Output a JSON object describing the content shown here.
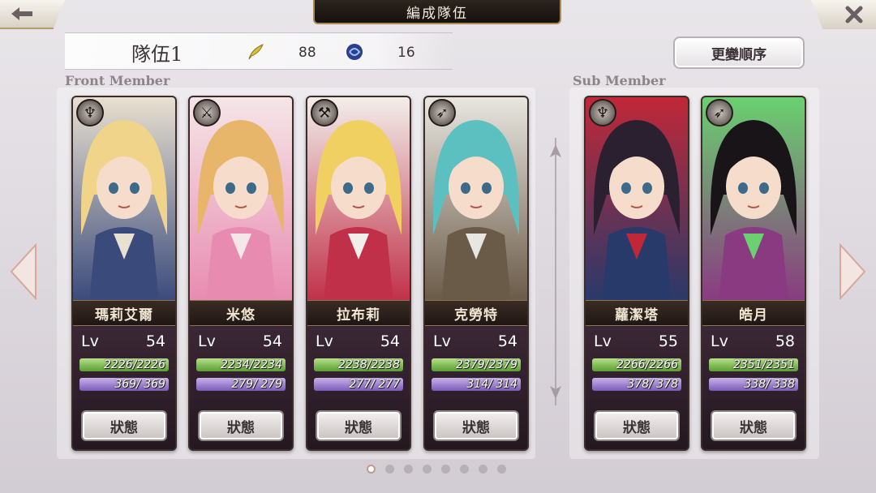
{
  "header": {
    "title": "編成隊伍",
    "back_icon": "left-arrow-icon",
    "close_icon": "close-icon"
  },
  "team": {
    "name": "隊伍1",
    "feather_value": "88",
    "orb_value": "16",
    "order_button": "更變順序"
  },
  "sections": {
    "front_label": "Front Member",
    "sub_label": "Sub Member"
  },
  "front_members": [
    {
      "name": "瑪莉艾爾",
      "lv_label": "Lv",
      "lv": "54",
      "hp": "2226/2226",
      "mp": "369/ 369",
      "class_icon": "staff-icon",
      "status": "狀態",
      "palette": [
        "#f0d48a",
        "#3a4a7a",
        "#e8e0d0"
      ]
    },
    {
      "name": "米悠",
      "lv_label": "Lv",
      "lv": "54",
      "hp": "2234/2234",
      "mp": "279/ 279",
      "class_icon": "sword-icon",
      "status": "狀態",
      "palette": [
        "#e8b66a",
        "#e88bb0",
        "#f5e6e8"
      ]
    },
    {
      "name": "拉布莉",
      "lv_label": "Lv",
      "lv": "54",
      "hp": "2238/2238",
      "mp": "277/ 277",
      "class_icon": "hammer-icon",
      "status": "狀態",
      "palette": [
        "#f0d060",
        "#c03048",
        "#f2eeea"
      ]
    },
    {
      "name": "克勞特",
      "lv_label": "Lv",
      "lv": "54",
      "hp": "2379/2379",
      "mp": "314/ 314",
      "class_icon": "bow-icon",
      "status": "狀態",
      "palette": [
        "#5cc0c0",
        "#6a5a48",
        "#e8e6e0"
      ]
    }
  ],
  "sub_members": [
    {
      "name": "蘿潔塔",
      "lv_label": "Lv",
      "lv": "55",
      "hp": "2266/2266",
      "mp": "378/ 378",
      "class_icon": "staff-icon",
      "status": "狀態",
      "palette": [
        "#2a2030",
        "#283a6a",
        "#c02838"
      ]
    },
    {
      "name": "皓月",
      "lv_label": "Lv",
      "lv": "58",
      "hp": "2351/2351",
      "mp": "338/ 338",
      "class_icon": "bow-icon",
      "status": "狀態",
      "palette": [
        "#181418",
        "#8a3a80",
        "#6ad070"
      ]
    }
  ],
  "pagination": {
    "total": 8,
    "active_index": 0
  }
}
